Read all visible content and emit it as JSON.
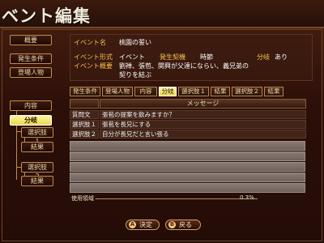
{
  "window": {
    "title": "ベント編集"
  },
  "left_nav": {
    "overview": "概要",
    "trigger": "発生条件",
    "characters": "登場人物",
    "tree": [
      {
        "label": "内容"
      },
      {
        "label": "分岐",
        "active": true
      },
      {
        "label": "選択肢１"
      },
      {
        "label": "結果"
      },
      {
        "label": "選択肢２"
      },
      {
        "label": "結果"
      }
    ]
  },
  "info": {
    "event_name_label": "イベント名",
    "event_name": "桃園の誓い",
    "format_label": "イベント形式",
    "format": "イベント",
    "trigger_label": "発生契機",
    "trigger": "時節",
    "branch_label": "分岐",
    "branch": "あり",
    "summary_label": "イベント概要",
    "summary_line1": "劉禅、張苞、関興が父達にならい、義兄弟の",
    "summary_line2": "契りを結ぶ"
  },
  "tabs": [
    {
      "label": "発生条件"
    },
    {
      "label": "登場人物"
    },
    {
      "label": "内容"
    },
    {
      "label": "分岐",
      "active": true
    },
    {
      "label": "選択肢１"
    },
    {
      "label": "結果"
    },
    {
      "label": "選択肢２"
    },
    {
      "label": "結果"
    }
  ],
  "grid": {
    "header_message": "メッセージ",
    "rows": [
      {
        "type": "質問文",
        "message": "張苞の提案を飲みますか？"
      },
      {
        "type": "選択肢１",
        "message": "張苞を長兄にする"
      },
      {
        "type": "選択肢２",
        "message": "自分が長兄だと言い張る"
      }
    ],
    "empty_rows": 7
  },
  "usage": {
    "label": "使用領域",
    "value": "0.3%",
    "fraction": 0.003
  },
  "buttons": {
    "confirm": "決定",
    "back": "戻る"
  },
  "colors": {
    "accent": "#f6c24a",
    "active_tab": "#e8d44c",
    "border": "#c48c4a"
  }
}
